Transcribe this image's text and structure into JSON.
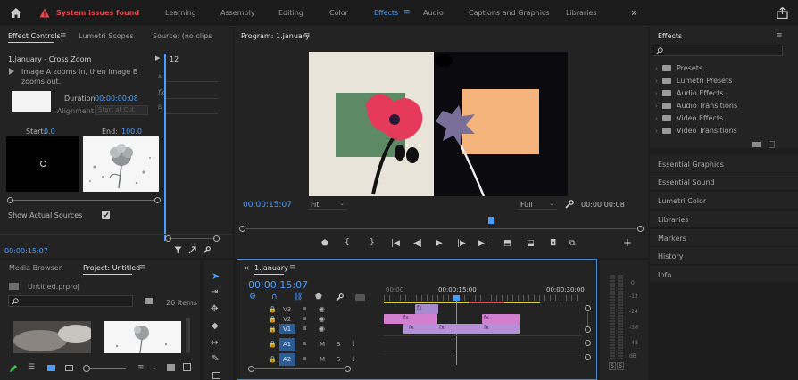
{
  "topbar": {
    "status": "System issues found",
    "workspaces": [
      "Learning",
      "Assembly",
      "Editing",
      "Color",
      "Effects",
      "Audio",
      "Captions and Graphics",
      "Libraries"
    ],
    "active_workspace": "Effects",
    "more": "»"
  },
  "effect_controls": {
    "tabs": [
      "Effect Controls",
      "Lumetri Scopes",
      "Source: (no clips"
    ],
    "clip_title": "1.january - Cross Zoom",
    "description": "Image A zooms in, then image B zooms out.",
    "duration_label": "Duration",
    "duration_value": "00:00:00:08",
    "alignment_label": "Alignment:",
    "alignment_value": "Start at Cut",
    "start_label": "Start:",
    "start_value": "0.0",
    "end_label": "End:",
    "end_value": "100.0",
    "show_actual_sources": "Show Actual Sources",
    "timecode": "00:00:15:07",
    "mini_time": "12",
    "mini_a": "A",
    "mini_b": "B",
    "mini_fx": "fx"
  },
  "program": {
    "title": "Program: 1.january",
    "timecode": "00:00:15:07",
    "fit": "Fit",
    "quality": "Full",
    "duration": "00:00:00:08"
  },
  "effects_panel": {
    "title": "Effects",
    "items": [
      "Presets",
      "Lumetri Presets",
      "Audio Effects",
      "Audio Transitions",
      "Video Effects",
      "Video Transitions"
    ],
    "sections": [
      "Essential Graphics",
      "Essential Sound",
      "Lumetri Color",
      "Libraries",
      "Markers",
      "History",
      "Info"
    ]
  },
  "project": {
    "tabs": [
      "Media Browser",
      "Project: Untitled"
    ],
    "file": "Untitled.prproj",
    "items_count": "26 items"
  },
  "timeline": {
    "tab": "1.january",
    "timecode": "00:00:15:07",
    "ruler": [
      "00:00",
      "00:00:15:00",
      "00:00:30:00"
    ],
    "tracks": [
      "V3",
      "V2",
      "V1",
      "A1",
      "A2"
    ],
    "clip_fx": "fx"
  },
  "audio_meter": {
    "scale": [
      "0",
      "-12",
      "-24",
      "-36",
      "-48",
      "dB"
    ],
    "solo": [
      "S",
      "S"
    ]
  },
  "colors": {
    "accent": "#4a9dff",
    "alert": "#e5484d",
    "clip_purple": "#a88bcf",
    "clip_pink": "#d27fd0"
  }
}
